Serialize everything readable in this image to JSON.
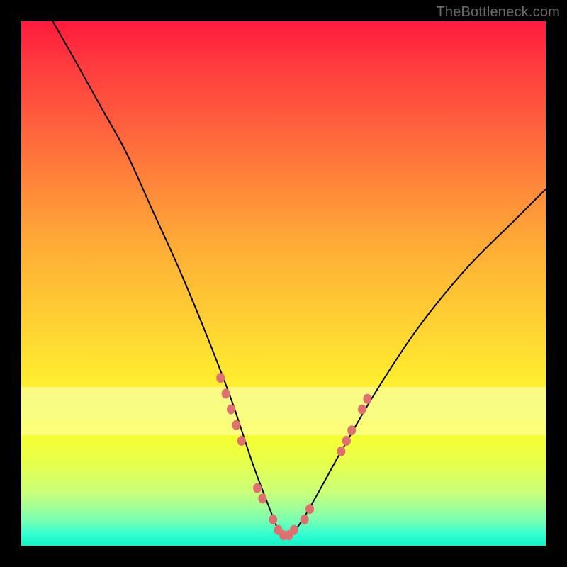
{
  "watermark": "TheBottleneck.com",
  "colors": {
    "frame_bg_top": "#ff1a3c",
    "frame_bg_bottom": "#17f0c5",
    "curve": "#000000",
    "marker": "#e07070",
    "page_bg": "#000000"
  },
  "chart_data": {
    "type": "line",
    "title": "",
    "xlabel": "",
    "ylabel": "",
    "xlim": [
      0,
      100
    ],
    "ylim": [
      0,
      100
    ],
    "series": [
      {
        "name": "bottleneck-curve",
        "x": [
          6,
          10,
          15,
          20,
          25,
          30,
          35,
          40,
          44,
          47,
          49,
          50,
          51,
          53,
          56,
          61,
          68,
          76,
          85,
          94,
          100
        ],
        "y": [
          100,
          93,
          84,
          75,
          64,
          53,
          41,
          28,
          16,
          8,
          3,
          2,
          2,
          4,
          9,
          18,
          30,
          42,
          53,
          62,
          68
        ]
      }
    ],
    "markers": {
      "name": "highlighted-points",
      "approx_xy": [
        [
          38,
          32
        ],
        [
          39,
          29
        ],
        [
          40,
          26
        ],
        [
          41,
          23
        ],
        [
          42,
          20
        ],
        [
          45,
          11
        ],
        [
          46,
          9
        ],
        [
          48,
          5
        ],
        [
          49,
          3
        ],
        [
          50,
          2
        ],
        [
          51,
          2
        ],
        [
          52,
          3
        ],
        [
          54,
          5
        ],
        [
          55,
          7
        ],
        [
          61,
          18
        ],
        [
          62,
          20
        ],
        [
          63,
          22
        ],
        [
          65,
          26
        ],
        [
          66,
          28
        ]
      ]
    },
    "bands": [
      {
        "name": "wide-yellow-band",
        "y_range": [
          24,
          30
        ]
      }
    ]
  }
}
